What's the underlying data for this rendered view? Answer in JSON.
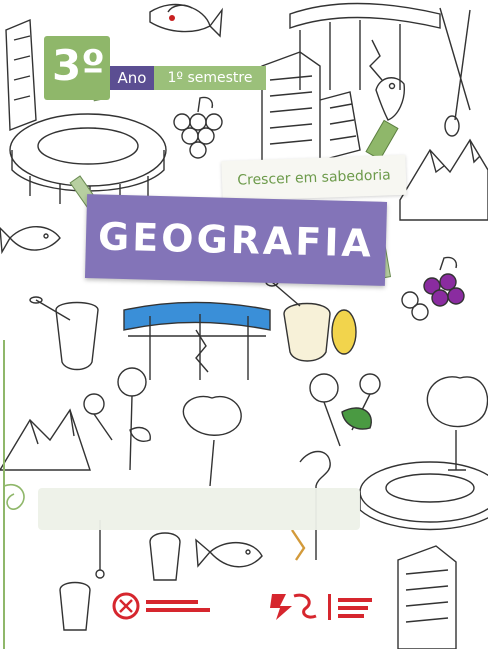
{
  "cover": {
    "grade_number": "3º",
    "ano_label": "Ano",
    "semester_label": "1º semestre",
    "tagline": "Crescer em sabedoria",
    "subject": "GEOGRAFIA"
  },
  "colors": {
    "green": "#8fb76a",
    "purple": "#5b4e92",
    "lavender": "#8374b8",
    "red": "#d6262e"
  }
}
